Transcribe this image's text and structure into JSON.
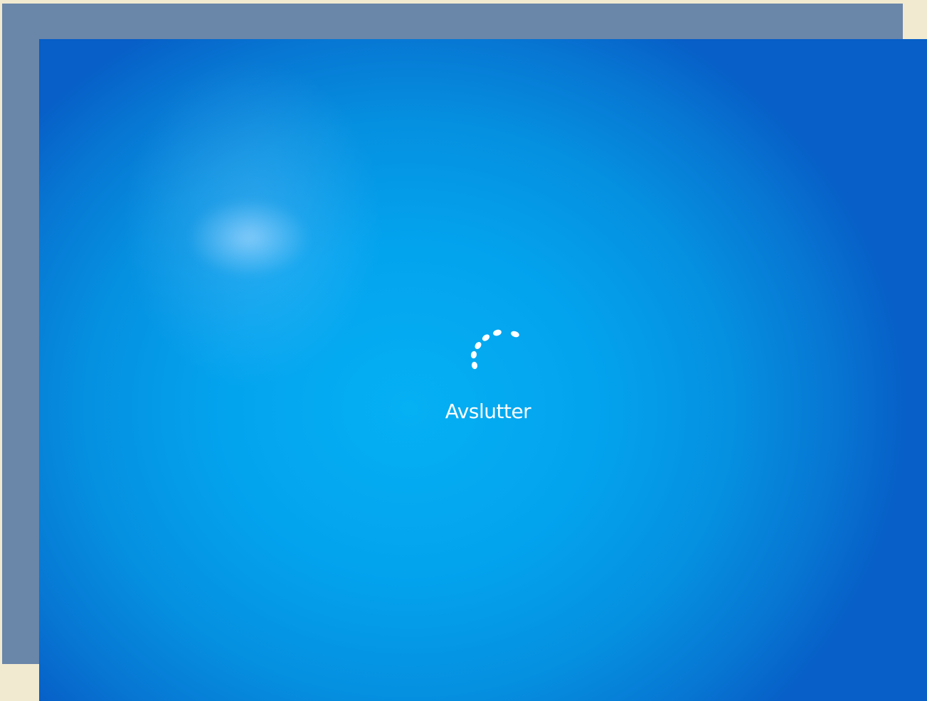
{
  "shutdown_screen": {
    "status_text": "Avslutter",
    "spinner_icon": "loading-dots-icon",
    "background_color": "#03a3ee",
    "text_color": "#ffffff"
  }
}
